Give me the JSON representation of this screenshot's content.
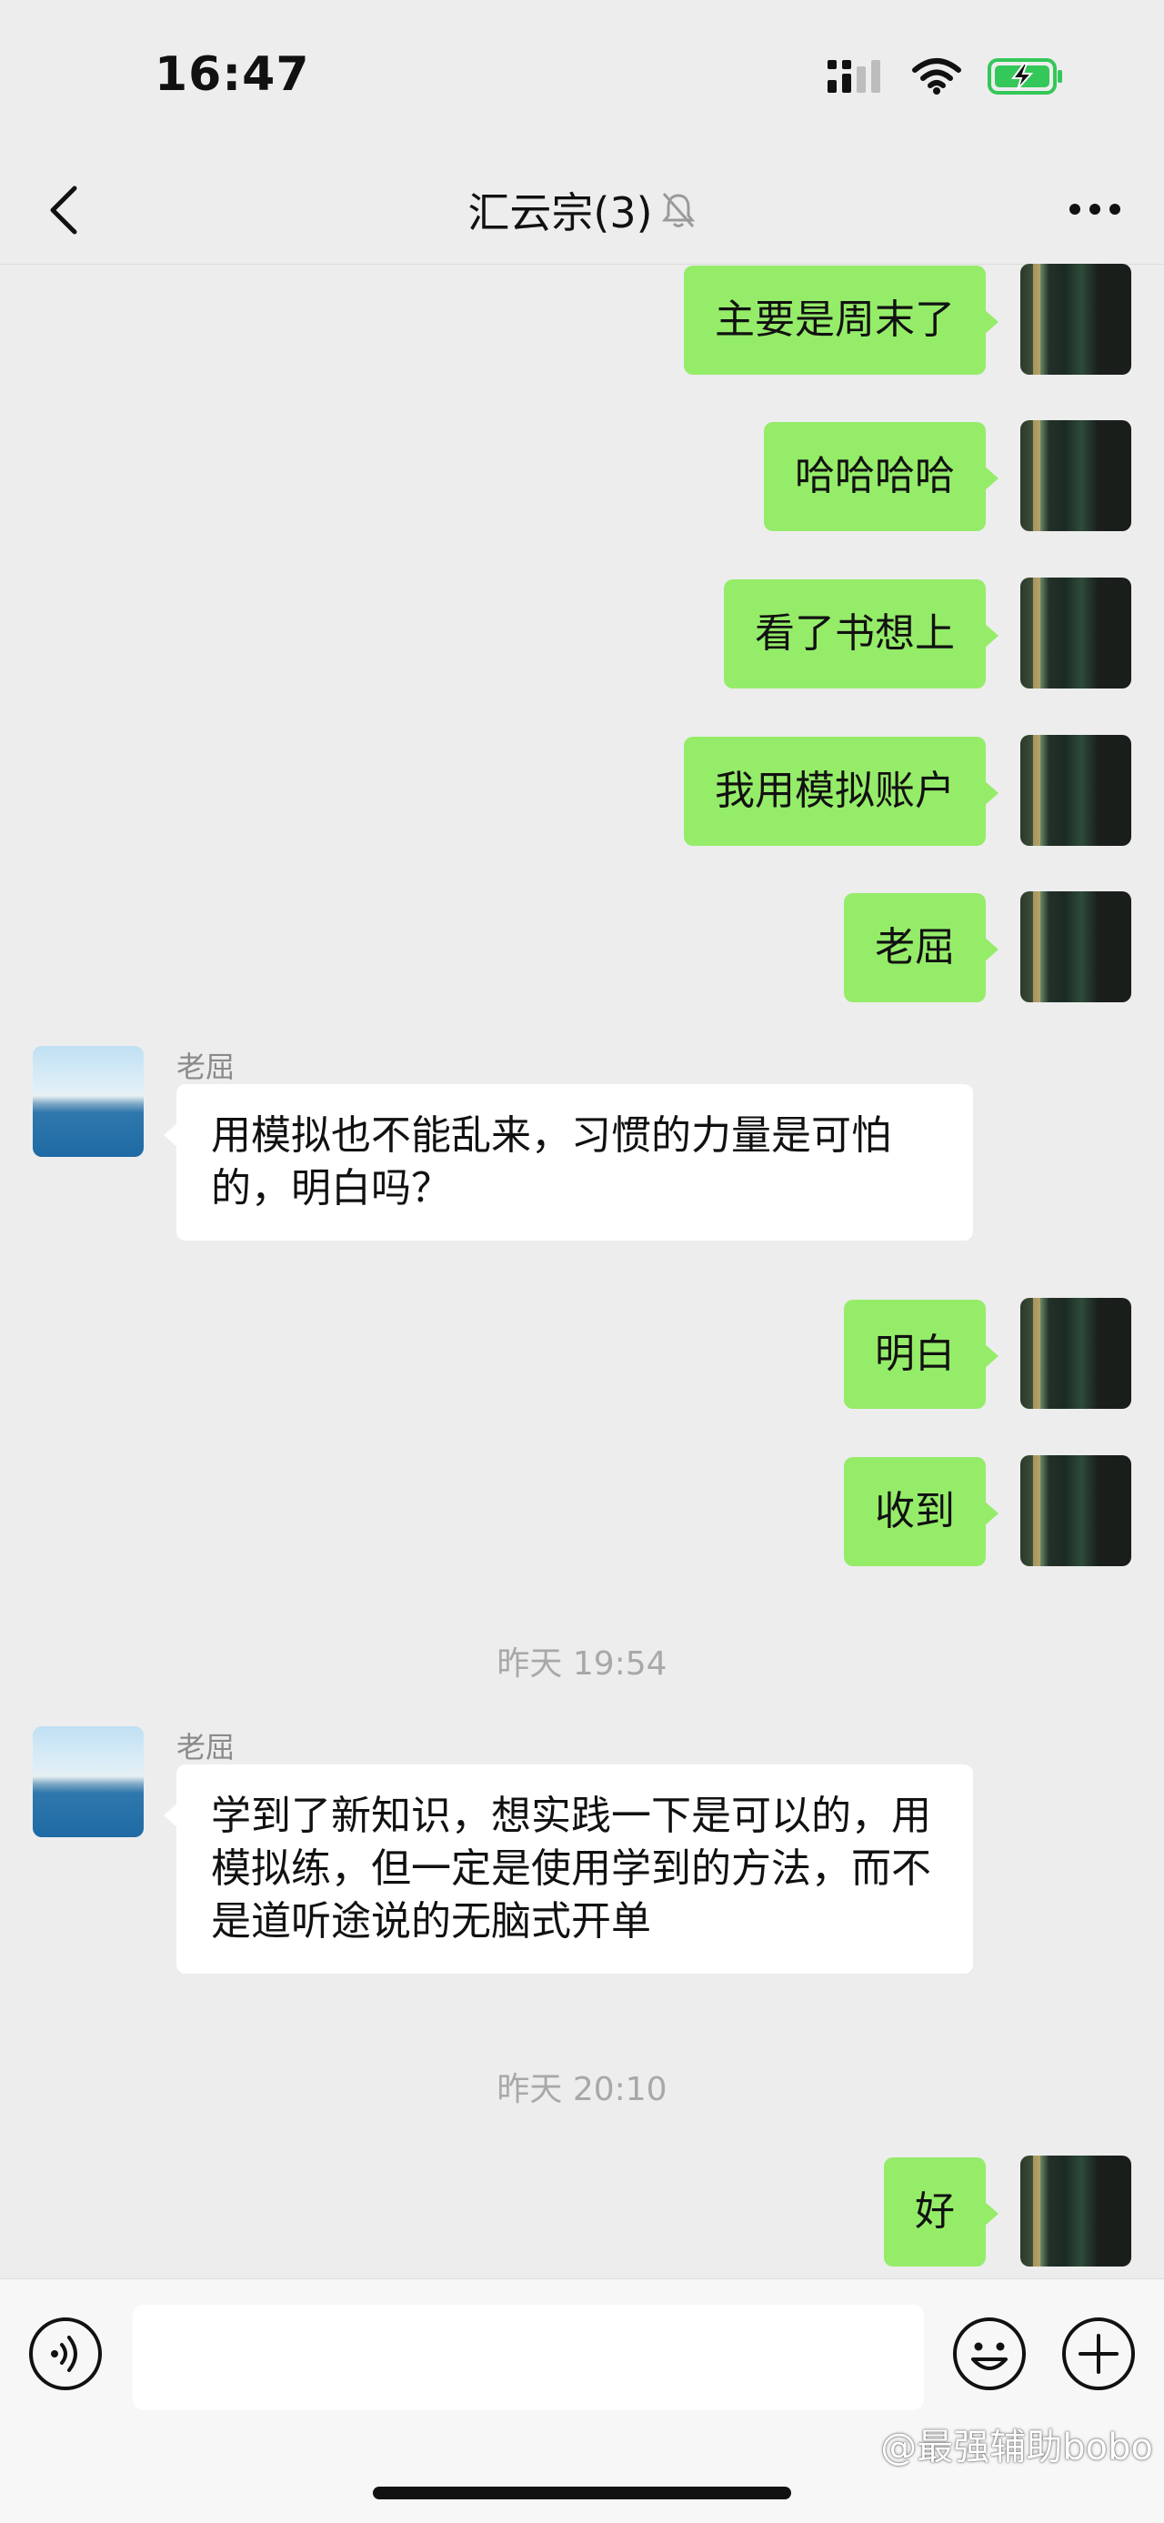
{
  "status_bar": {
    "time": "16:47",
    "icons": [
      "signal-icon",
      "wifi-icon",
      "battery-charging-icon"
    ]
  },
  "nav": {
    "title": "汇云宗(3)",
    "back_icon": "chevron-left-icon",
    "mute_icon": "bell-muted-icon",
    "more_icon": "more-dots-icon"
  },
  "messages": [
    {
      "from": "self",
      "text": "主要是周末了"
    },
    {
      "from": "self",
      "text": "哈哈哈哈"
    },
    {
      "from": "self",
      "text": "看了书想上"
    },
    {
      "from": "self",
      "text": "我用模拟账户"
    },
    {
      "from": "self",
      "text": "老屈"
    },
    {
      "from": "other",
      "sender": "老屈",
      "text": "用模拟也不能乱来，习惯的力量是可怕的，明白吗？"
    },
    {
      "from": "self",
      "text": "明白"
    },
    {
      "from": "self",
      "text": "收到"
    },
    {
      "type": "time",
      "text": "昨天 19:54"
    },
    {
      "from": "other",
      "sender": "老屈",
      "text": "学到了新知识，想实践一下是可以的，用模拟练，但一定是使用学到的方法，而不是道听途说的无脑式开单"
    },
    {
      "type": "time",
      "text": "昨天 20:10"
    },
    {
      "from": "self",
      "text": "好"
    }
  ],
  "input_bar": {
    "voice_icon": "voice-icon",
    "input_placeholder": "",
    "emoji_icon": "emoji-icon",
    "plus_icon": "plus-icon"
  },
  "watermark": "@最强辅助bobo",
  "colors": {
    "background": "#ededed",
    "self_bubble": "#95ec69",
    "other_bubble": "#ffffff"
  }
}
